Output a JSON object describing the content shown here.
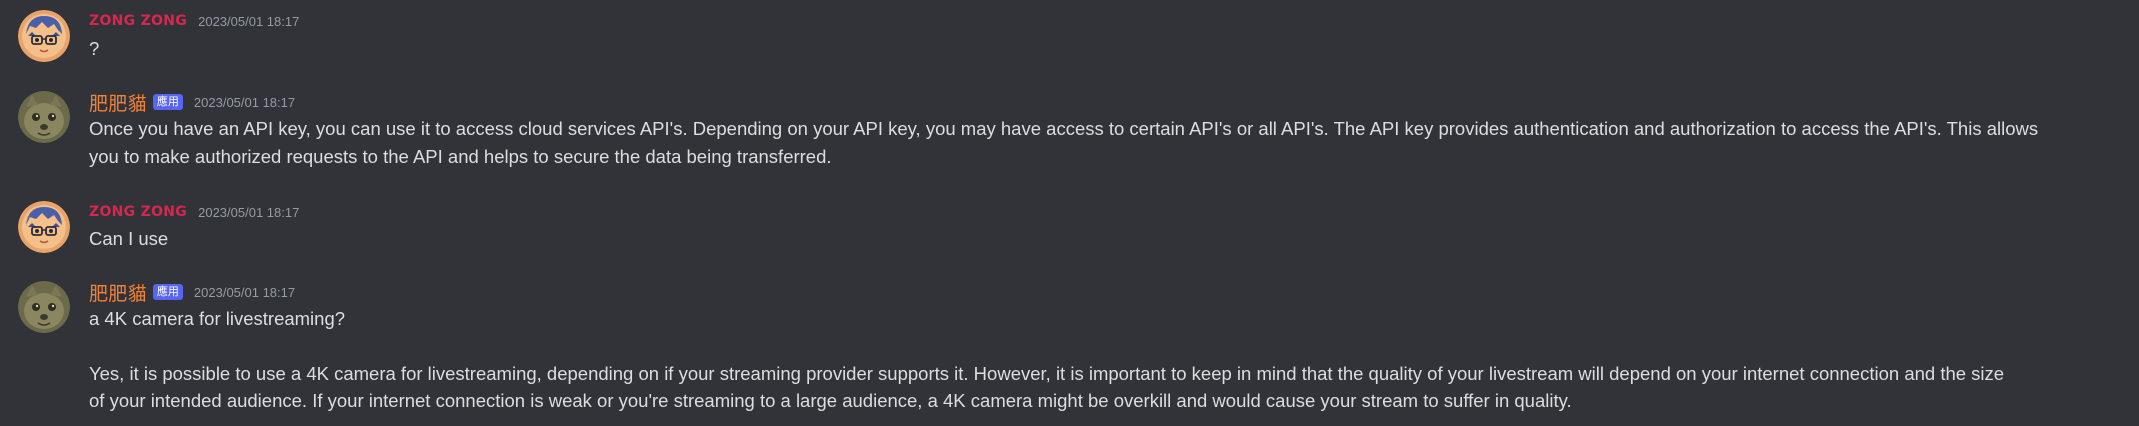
{
  "messages": [
    {
      "author": "ZONG ZONG",
      "timestamp": "2023/05/01 18:17",
      "avatar_icon": "anime-avatar-icon",
      "lines": [
        "?"
      ]
    },
    {
      "author": "肥肥貓",
      "badge": "應用",
      "timestamp": "2023/05/01 18:17",
      "avatar_icon": "cat-avatar-icon",
      "lines": [
        "Once you have an API key, you can use it to access cloud services API's. Depending on your API key, you may have access to certain API's or all API's. The API key provides authentication and authorization to access the API's. This allows",
        "you to make authorized requests to the API and helps to secure the data being transferred."
      ]
    },
    {
      "author": "ZONG ZONG",
      "timestamp": "2023/05/01 18:17",
      "avatar_icon": "anime-avatar-icon",
      "lines": [
        "Can I use"
      ]
    },
    {
      "author": "肥肥貓",
      "badge": "應用",
      "timestamp": "2023/05/01 18:17",
      "avatar_icon": "cat-avatar-icon",
      "lines": [
        "a 4K camera for livestreaming?",
        "Yes, it is possible to use a 4K camera for livestreaming, depending on if your streaming provider supports it. However, it is important to keep in mind that the quality of your livestream will depend on your internet connection and the size",
        "of your intended audience. If your internet connection is weak or you're streaming to a large audience, a 4K camera might be overkill and would cause your stream to suffer in quality."
      ]
    }
  ],
  "colors": {
    "background": "#313338",
    "zong_name": "#d7264f",
    "cat_name": "#f0813b",
    "badge": "#5865f2",
    "timestamp": "#949ba4",
    "text": "#dbdee1"
  }
}
